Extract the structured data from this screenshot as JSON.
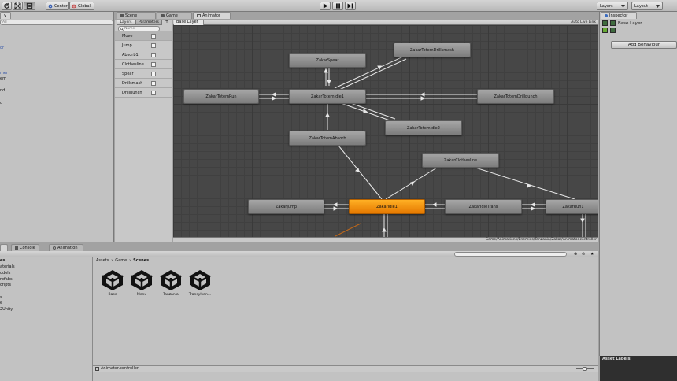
{
  "toolbar": {
    "pivot": "Center",
    "space": "Global",
    "layers": "Layers",
    "layout": "Layout"
  },
  "left_panel": {
    "tab_label": "y",
    "search_placeholder": "All",
    "items": [
      "or",
      "mer",
      "em",
      "nd",
      "u"
    ]
  },
  "tabs": {
    "scene": "Scene",
    "game": "Game",
    "animator": "Animator"
  },
  "parameters": {
    "tab_layers": "Layers",
    "tab_parameters": "Parameters",
    "search_placeholder": "Name",
    "items": [
      "Move",
      "Jump",
      "Absorb1",
      "Clothesline",
      "Spear",
      "Drillsmash",
      "Drillpunch"
    ]
  },
  "animator": {
    "layer_breadcrumb": "Base Layer",
    "auto_live_link": "Auto Live Link",
    "footer_path": "Game/Animations/Enemies/Tanzania/Zakar/Animator.controller",
    "states": [
      "ZakarSpear",
      "ZakarTotemDrillsmash",
      "ZakarTotemRun",
      "ZakarTotemIdle1",
      "ZakarTotemDrillpunch",
      "ZakarTotemIdle2",
      "ZakarTotemAbsorb",
      "ZakarClothesline",
      "ZakarJump",
      "ZakarIdle1",
      "ZakarIdleTrans",
      "ZakarRun1"
    ],
    "default_state": "ZakarIdle1"
  },
  "inspector": {
    "tab": "Inspector",
    "layer_name": "Base Layer",
    "add_behaviour": "Add Behaviour",
    "asset_labels": "Asset Labels"
  },
  "bottom_tabs": {
    "console": "Console",
    "animation": "Animation"
  },
  "project": {
    "tree": [
      "es",
      "aterials",
      "odels",
      "refabs",
      "cripts",
      "s",
      "e",
      "2Unity"
    ],
    "breadcrumb": [
      "Assets",
      "Game",
      "Scenes"
    ],
    "scenes": [
      "Base",
      "Menu",
      "Tanzania",
      "Transylvan..."
    ],
    "selected_file": "Animator.controller"
  },
  "colors": {
    "graph_bg": "#474747",
    "node_default": "#f08c12",
    "node_normal": "#8f8f8f",
    "editor_bg": "#c2c2c2"
  }
}
